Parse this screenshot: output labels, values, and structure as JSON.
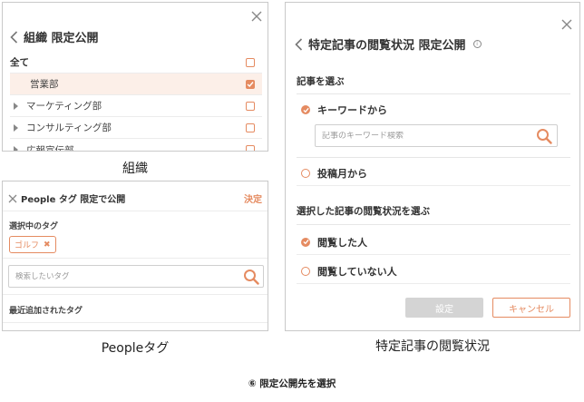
{
  "org_panel": {
    "title": "組織 限定公開",
    "rows": [
      {
        "label": "全て",
        "checked": false
      },
      {
        "label": "営業部",
        "checked": true
      },
      {
        "label": "マーケティング部",
        "checked": false
      },
      {
        "label": "コンサルティング部",
        "checked": false
      },
      {
        "label": "広報宣伝部",
        "checked": false
      }
    ],
    "caption": "組織"
  },
  "people_panel": {
    "title": "People タグ 限定で公開",
    "decide_label": "決定",
    "selected_heading": "選択中のタグ",
    "selected_tag": "ゴルフ",
    "search_placeholder": "検索したいタグ",
    "recent_heading": "最近追加されたタグ",
    "caption": "Peopleタグ"
  },
  "article_panel": {
    "title": "特定記事の閲覧状況 限定公開",
    "info_glyph": "i",
    "select_heading": "記事を選ぶ",
    "option_keyword": "キーワードから",
    "keyword_placeholder": "記事のキーワード検索",
    "option_month": "投稿月から",
    "status_heading": "選択した記事の閲覧状況を選ぶ",
    "option_viewed": "閲覧した人",
    "option_not_viewed": "閲覧していない人",
    "set_button": "設定",
    "cancel_button": "キャンセル",
    "caption": "特定記事の閲覧状況"
  },
  "footer": "⑥ 限定公開先を選択",
  "colors": {
    "accent": "#e58b61",
    "border": "#c9c9c9",
    "disabled": "#d4d4d4"
  }
}
